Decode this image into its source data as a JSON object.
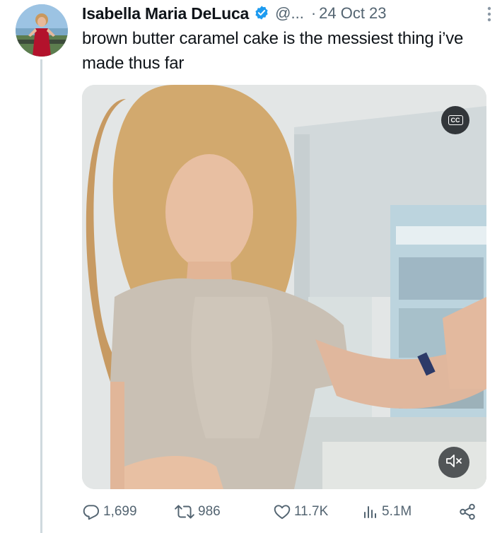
{
  "tweet": {
    "author_name": "Isabella Maria DeLuca",
    "handle": "@...",
    "separator": "·",
    "date": "24 Oct 23",
    "text": "brown butter caramel cake is the messiest thing i’ve made thus far"
  },
  "media": {
    "cc_label": "CC",
    "muted": true
  },
  "actions": {
    "replies": "1,699",
    "retweets": "986",
    "likes": "11.7K",
    "views": "5.1M"
  },
  "icons": {
    "verified": "verified-badge-icon",
    "more": "more-vertical-icon",
    "reply": "reply-icon",
    "retweet": "retweet-icon",
    "like": "heart-icon",
    "views": "views-icon",
    "share": "share-icon",
    "mute": "speaker-muted-icon"
  },
  "colors": {
    "verified": "#1d9bf0",
    "secondary_text": "#536471",
    "thread_line": "#cfd9de"
  }
}
